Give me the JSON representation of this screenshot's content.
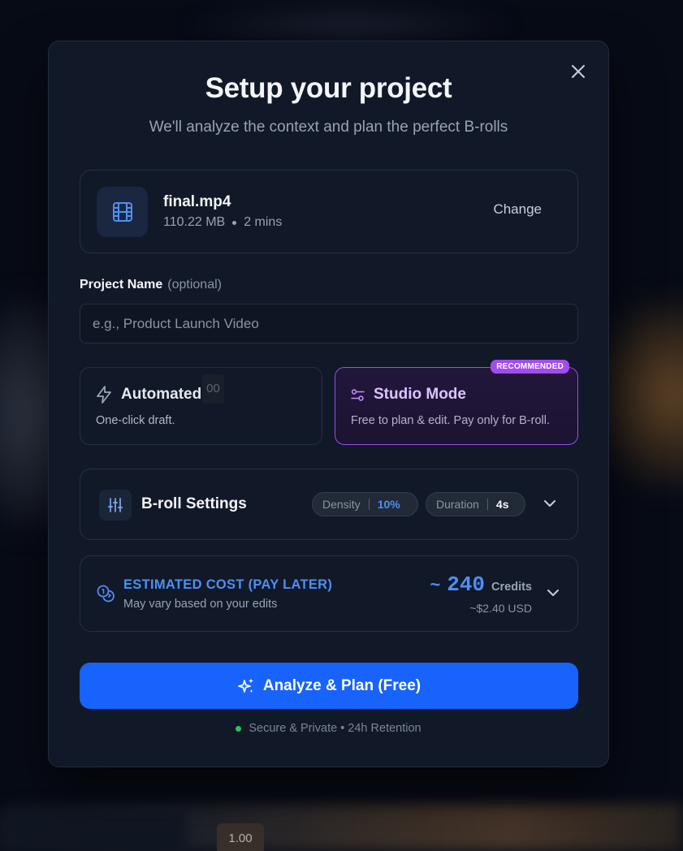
{
  "modal": {
    "title": "Setup your project",
    "subtitle": "We'll analyze the context and plan the perfect B-rolls",
    "close_icon": "close-icon"
  },
  "file": {
    "name": "final.mp4",
    "size": "110.22 MB",
    "duration": "2 mins",
    "change_label": "Change",
    "icon": "film-icon"
  },
  "project_name": {
    "label": "Project Name",
    "optional": "(optional)",
    "value": "",
    "placeholder": "e.g., Product Launch Video"
  },
  "modes": {
    "automated": {
      "title": "Automated",
      "desc": "One-click draft.",
      "icon": "lightning-icon",
      "ghost": "00"
    },
    "studio": {
      "title": "Studio Mode",
      "desc": "Free to plan & edit. Pay only for B-roll.",
      "icon": "sliders-icon",
      "badge": "RECOMMENDED",
      "selected": true
    }
  },
  "broll": {
    "title": "B-roll Settings",
    "density_label": "Density",
    "density_value": "10%",
    "duration_label": "Duration",
    "duration_value": "4s"
  },
  "cost": {
    "title": "ESTIMATED COST (PAY LATER)",
    "subtitle": "May vary based on your edits",
    "tilde": "~",
    "amount": "240",
    "unit": "Credits",
    "usd": "~$2.40 USD"
  },
  "cta": {
    "label": "Analyze & Plan (Free)",
    "icon": "sparkles-icon"
  },
  "footer": {
    "note": "Secure & Private • 24h Retention"
  },
  "background": {
    "badge": "1.00"
  },
  "colors": {
    "accent": "#1763fb",
    "accent_text": "#4d8ff6",
    "studio_border": "#9b4dea",
    "badge": "#a24cf0",
    "secure_dot": "#22c55e"
  }
}
